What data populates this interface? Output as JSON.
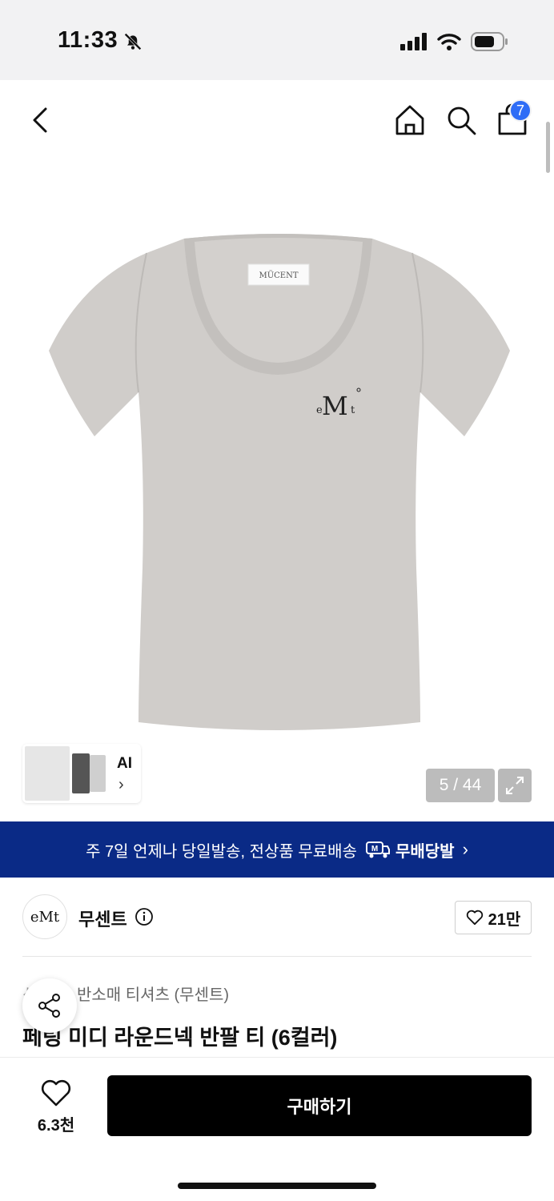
{
  "status_bar": {
    "time": "11:33"
  },
  "nav": {
    "cart_count": "7"
  },
  "hero": {
    "tag_text": "MÜCENT",
    "logo_left": "e",
    "logo_main": "M",
    "logo_right": "t",
    "ai_label": "AI",
    "page_counter": "5 / 44"
  },
  "banner": {
    "text": "주 7일 언제나 당일발송, 전상품 무료배송",
    "brand": "무배당발",
    "brand_badge": "M"
  },
  "seller": {
    "logo_text": "eMt",
    "name": "무센트",
    "likes": "21만"
  },
  "product": {
    "breadcrumb_prefix": "신",
    "breadcrumb": "반소매 티셔츠 (무센트)",
    "title": "페팅 미디 라운드넥 반팔 티 (6컬러)"
  },
  "bottom": {
    "wish_count": "6.3천",
    "buy_label": "구매하기"
  }
}
